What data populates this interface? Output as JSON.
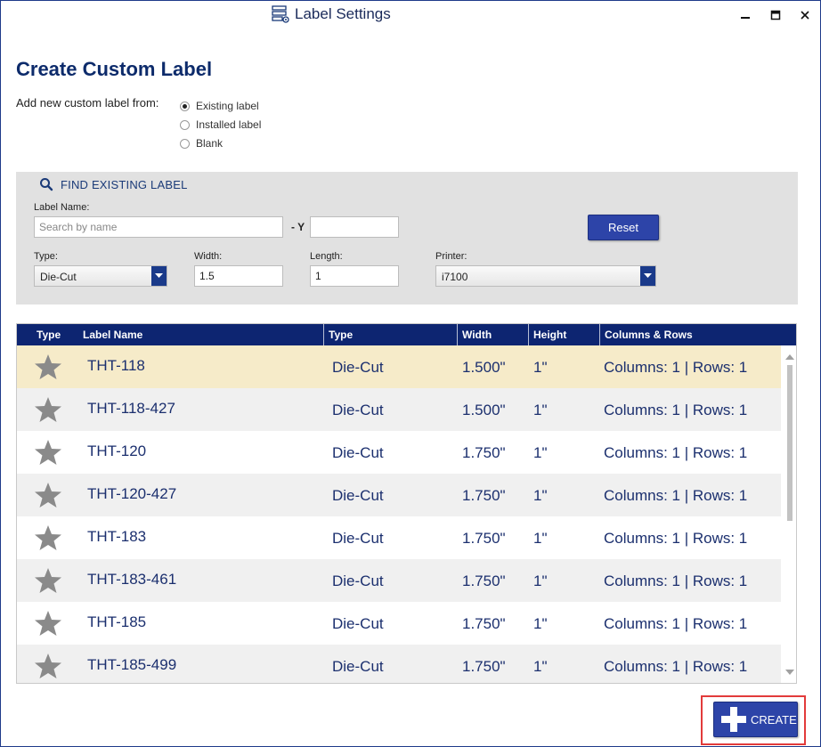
{
  "window": {
    "title": "Label Settings",
    "title_icon": "server-gear-icon",
    "minimize_glyph": "—",
    "maximize_glyph": "■",
    "close_glyph": "✕"
  },
  "heading": "Create Custom Label",
  "add_from": {
    "label": "Add new custom label from:",
    "options": [
      {
        "label": "Existing label",
        "selected": true
      },
      {
        "label": "Installed label",
        "selected": false
      },
      {
        "label": "Blank",
        "selected": false
      }
    ]
  },
  "find": {
    "title": "FIND EXISTING LABEL",
    "label_name_label": "Label Name:",
    "label_name_placeholder": "Search by name",
    "y_label": "- Y",
    "y_value": "",
    "reset_label": "Reset",
    "type_label": "Type:",
    "type_value": "Die-Cut",
    "width_label": "Width:",
    "width_value": "1.5",
    "length_label": "Length:",
    "length_value": "1",
    "printer_label": "Printer:",
    "printer_value": "i7100"
  },
  "table": {
    "columns": [
      "Type",
      "Label Name",
      "Type",
      "Width",
      "Height",
      "Columns & Rows"
    ],
    "rows": [
      {
        "name": "THT-118",
        "type": "Die-Cut",
        "width": "1.500\"",
        "height": "1\"",
        "cr": "Columns: 1 | Rows: 1",
        "selected": true
      },
      {
        "name": "THT-118-427",
        "type": "Die-Cut",
        "width": "1.500\"",
        "height": "1\"",
        "cr": "Columns: 1 | Rows: 1",
        "selected": false
      },
      {
        "name": "THT-120",
        "type": "Die-Cut",
        "width": "1.750\"",
        "height": "1\"",
        "cr": "Columns: 1 | Rows: 1",
        "selected": false
      },
      {
        "name": "THT-120-427",
        "type": "Die-Cut",
        "width": "1.750\"",
        "height": "1\"",
        "cr": "Columns: 1 | Rows: 1",
        "selected": false
      },
      {
        "name": "THT-183",
        "type": "Die-Cut",
        "width": "1.750\"",
        "height": "1\"",
        "cr": "Columns: 1 | Rows: 1",
        "selected": false
      },
      {
        "name": "THT-183-461",
        "type": "Die-Cut",
        "width": "1.750\"",
        "height": "1\"",
        "cr": "Columns: 1 | Rows: 1",
        "selected": false
      },
      {
        "name": "THT-185",
        "type": "Die-Cut",
        "width": "1.750\"",
        "height": "1\"",
        "cr": "Columns: 1 | Rows: 1",
        "selected": false
      },
      {
        "name": "THT-185-499",
        "type": "Die-Cut",
        "width": "1.750\"",
        "height": "1\"",
        "cr": "Columns: 1 | Rows: 1",
        "selected": false
      }
    ]
  },
  "create_label": "CREATE",
  "colors": {
    "header_bg": "#0d2571",
    "button_bg": "#2d44a8",
    "selected_row": "#f6ebc9",
    "alt_row": "#f0f0f0",
    "highlight_outline": "#e23b3b",
    "star": "#8a8a8a"
  }
}
